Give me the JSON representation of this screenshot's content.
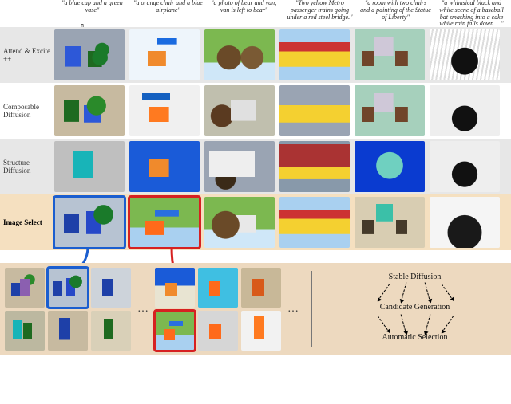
{
  "prompts": [
    "\"a blue cup and a green vase\"",
    "\"a orange chair and a blue airplane\"",
    "\"a photo of bear and van; van is left to bear\"",
    "\"Two yellow Metro passenger trains going under a red steel bridge.\"",
    "\"a room with two chairs and a painting of the Statue of Liberty\"",
    "\"a whimsical black and white scene of a baseball bat smashing into a cake while rain falls down …\""
  ],
  "rows": [
    {
      "label": "Attend & Excite ++",
      "id": "attend-excite"
    },
    {
      "label": "Composable Diffusion",
      "id": "composable-diffusion"
    },
    {
      "label": "Structure Diffusion",
      "id": "structure-diffusion"
    },
    {
      "label": "Image Select",
      "id": "image-select",
      "bold": true
    }
  ],
  "diagram": {
    "node1": "Stable Diffusion",
    "node2": "Candidate Generation",
    "node3": "Automatic Selection"
  },
  "ellipsis": "…",
  "selection": {
    "blue_prompt_index": 0,
    "red_prompt_index": 1
  }
}
